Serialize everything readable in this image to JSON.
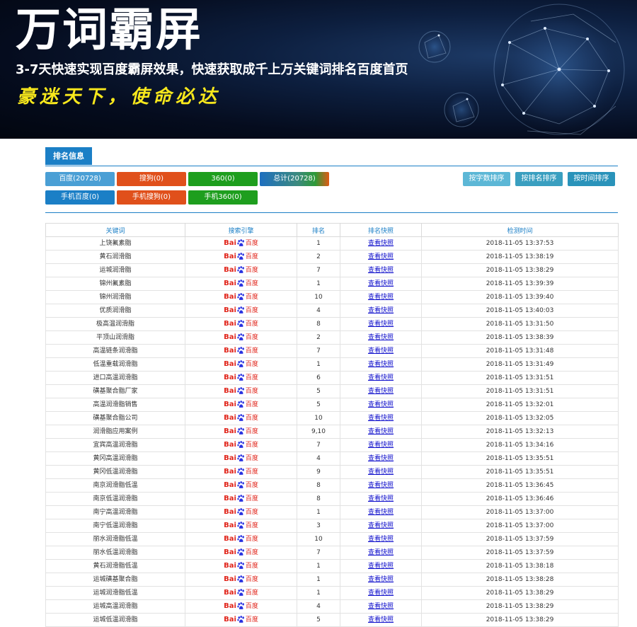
{
  "banner": {
    "title": "万词霸屏",
    "subtitle": "3-7天快速实现百度霸屏效果，快速获取成千上万关键词排名百度首页",
    "slogan": "豪迷天下，使命必达"
  },
  "section_tab": "排名信息",
  "filters": {
    "baidu": "百度(20728)",
    "sogou": "搜狗(0)",
    "s360": "360(0)",
    "total": "总计(20728)",
    "m_baidu": "手机百度(0)",
    "m_sogou": "手机搜狗(0)",
    "m_360": "手机360(0)"
  },
  "sort": {
    "by_chars": "按字数排序",
    "by_rank": "按排名排序",
    "by_time": "按时间排序"
  },
  "table": {
    "headers": [
      "关键词",
      "搜索引擎",
      "排名",
      "排名快照",
      "检测时间"
    ],
    "engine_logo": {
      "left": "Bai",
      "right": "百度"
    },
    "rows": [
      {
        "keyword": "上饶氟素脂",
        "rank": "1",
        "snapshot": "查看快照",
        "time": "2018-11-05 13:37:53"
      },
      {
        "keyword": "黄石润滑脂",
        "rank": "2",
        "snapshot": "查看快照",
        "time": "2018-11-05 13:38:19"
      },
      {
        "keyword": "运城润滑脂",
        "rank": "7",
        "snapshot": "查看快照",
        "time": "2018-11-05 13:38:29"
      },
      {
        "keyword": "锦州氟素脂",
        "rank": "1",
        "snapshot": "查看快照",
        "time": "2018-11-05 13:39:39"
      },
      {
        "keyword": "锦州润滑脂",
        "rank": "10",
        "snapshot": "查看快照",
        "time": "2018-11-05 13:39:40"
      },
      {
        "keyword": "优质润滑脂",
        "rank": "4",
        "snapshot": "查看快照",
        "time": "2018-11-05 13:40:03"
      },
      {
        "keyword": "极高温润滑脂",
        "rank": "8",
        "snapshot": "查看快照",
        "time": "2018-11-05 13:31:50"
      },
      {
        "keyword": "平顶山润滑脂",
        "rank": "2",
        "snapshot": "查看快照",
        "time": "2018-11-05 13:38:39"
      },
      {
        "keyword": "高温链条润滑脂",
        "rank": "7",
        "snapshot": "查看快照",
        "time": "2018-11-05 13:31:48"
      },
      {
        "keyword": "低温重载润滑脂",
        "rank": "1",
        "snapshot": "查看快照",
        "time": "2018-11-05 13:31:49"
      },
      {
        "keyword": "进口高温润滑脂",
        "rank": "6",
        "snapshot": "查看快照",
        "time": "2018-11-05 13:31:51"
      },
      {
        "keyword": "磺基聚合脂厂家",
        "rank": "5",
        "snapshot": "查看快照",
        "time": "2018-11-05 13:31:51"
      },
      {
        "keyword": "高温润滑脂销售",
        "rank": "5",
        "snapshot": "查看快照",
        "time": "2018-11-05 13:32:01"
      },
      {
        "keyword": "磺基聚合脂公司",
        "rank": "10",
        "snapshot": "查看快照",
        "time": "2018-11-05 13:32:05"
      },
      {
        "keyword": "润滑脂应用案例",
        "rank": "9,10",
        "snapshot": "查看快照",
        "time": "2018-11-05 13:32:13"
      },
      {
        "keyword": "宜宾高温润滑脂",
        "rank": "7",
        "snapshot": "查看快照",
        "time": "2018-11-05 13:34:16"
      },
      {
        "keyword": "黄冈高温润滑脂",
        "rank": "4",
        "snapshot": "查看快照",
        "time": "2018-11-05 13:35:51"
      },
      {
        "keyword": "黄冈低温润滑脂",
        "rank": "9",
        "snapshot": "查看快照",
        "time": "2018-11-05 13:35:51"
      },
      {
        "keyword": "南京润滑脂低温",
        "rank": "8",
        "snapshot": "查看快照",
        "time": "2018-11-05 13:36:45"
      },
      {
        "keyword": "南京低温润滑脂",
        "rank": "8",
        "snapshot": "查看快照",
        "time": "2018-11-05 13:36:46"
      },
      {
        "keyword": "南宁高温润滑脂",
        "rank": "1",
        "snapshot": "查看快照",
        "time": "2018-11-05 13:37:00"
      },
      {
        "keyword": "南宁低温润滑脂",
        "rank": "3",
        "snapshot": "查看快照",
        "time": "2018-11-05 13:37:00"
      },
      {
        "keyword": "丽水润滑脂低温",
        "rank": "10",
        "snapshot": "查看快照",
        "time": "2018-11-05 13:37:59"
      },
      {
        "keyword": "丽水低温润滑脂",
        "rank": "7",
        "snapshot": "查看快照",
        "time": "2018-11-05 13:37:59"
      },
      {
        "keyword": "黄石润滑脂低温",
        "rank": "1",
        "snapshot": "查看快照",
        "time": "2018-11-05 13:38:18"
      },
      {
        "keyword": "运城磺基聚合脂",
        "rank": "1",
        "snapshot": "查看快照",
        "time": "2018-11-05 13:38:28"
      },
      {
        "keyword": "运城润滑脂低温",
        "rank": "1",
        "snapshot": "查看快照",
        "time": "2018-11-05 13:38:29"
      },
      {
        "keyword": "运城高温润滑脂",
        "rank": "4",
        "snapshot": "查看快照",
        "time": "2018-11-05 13:38:29"
      },
      {
        "keyword": "运城低温润滑脂",
        "rank": "5",
        "snapshot": "查看快照",
        "time": "2018-11-05 13:38:29"
      }
    ]
  }
}
